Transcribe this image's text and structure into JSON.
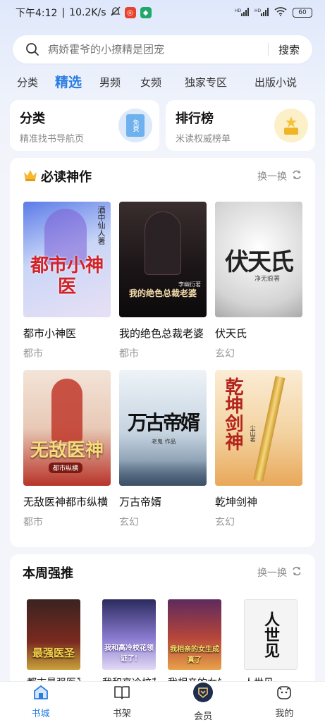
{
  "status_bar": {
    "time": "下午4:12",
    "speed": "10.2K/s",
    "signal_1": "HD",
    "signal_2": "HD",
    "battery": "60"
  },
  "search": {
    "placeholder": "病娇霍爷的小撩精是团宠",
    "button_label": "搜索"
  },
  "tabs": [
    {
      "label": "分类"
    },
    {
      "label": "精选",
      "active": true
    },
    {
      "label": "男频"
    },
    {
      "label": "女频"
    },
    {
      "label": "独家专区"
    },
    {
      "label": "出版小说"
    }
  ],
  "quick_cards": [
    {
      "title": "分类",
      "subtitle": "精准找书导航页",
      "icon": "book-category-icon",
      "icon_text": "免费"
    },
    {
      "title": "排行榜",
      "subtitle": "米读权威榜单",
      "icon": "trophy-icon"
    }
  ],
  "must_read": {
    "title": "必读神作",
    "icon": "crown-icon",
    "refresh_label": "换一换",
    "books": [
      {
        "title": "都市小神医",
        "genre": "都市",
        "cover_text": "都市小神医",
        "cover_author": "酒中仙人著",
        "color": "#3b6fd8"
      },
      {
        "title": "我的绝色总裁老婆",
        "genre": "都市",
        "cover_text": "我的绝色总裁老婆",
        "cover_author": "李幽衍著",
        "color": "#1d1a1f"
      },
      {
        "title": "伏天氏",
        "genre": "玄幻",
        "cover_text": "伏天氏",
        "cover_author": "净无痕著",
        "color": "#d6d6d6"
      },
      {
        "title": "无敌医神都市纵横",
        "genre": "都市",
        "cover_text": "无敌医神",
        "cover_author": "都市纵横",
        "color": "#c0392b"
      },
      {
        "title": "万古帝婿",
        "genre": "玄幻",
        "cover_text": "万古帝婿",
        "cover_author": "老鬼 作品",
        "color": "#6b8aa8"
      },
      {
        "title": "乾坤剑神",
        "genre": "玄幻",
        "cover_text": "乾坤剑神",
        "cover_author": "尘山著",
        "color": "#d98a2b"
      }
    ]
  },
  "weekly": {
    "title": "本周强推",
    "refresh_label": "换一换",
    "books": [
      {
        "title": "都市最强医圣",
        "cover_text": "最强医圣",
        "color": "#7a2a1f"
      },
      {
        "title": "我和高冷校花领证了",
        "cover_text": "我和高冷校花领证了!",
        "color": "#8a7ad0"
      },
      {
        "title": "我相亲的女生成真了",
        "cover_text": "我相亲的女生成真了",
        "color": "#b6463a"
      },
      {
        "title": "人世见",
        "cover_text": "人世见",
        "color": "#eeeeee"
      }
    ]
  },
  "bottom_nav": [
    {
      "label": "书城",
      "icon": "bookstore-icon",
      "active": true
    },
    {
      "label": "书架",
      "icon": "bookshelf-icon"
    },
    {
      "label": "会员",
      "icon": "vip-icon"
    },
    {
      "label": "我的",
      "icon": "profile-icon"
    }
  ]
}
